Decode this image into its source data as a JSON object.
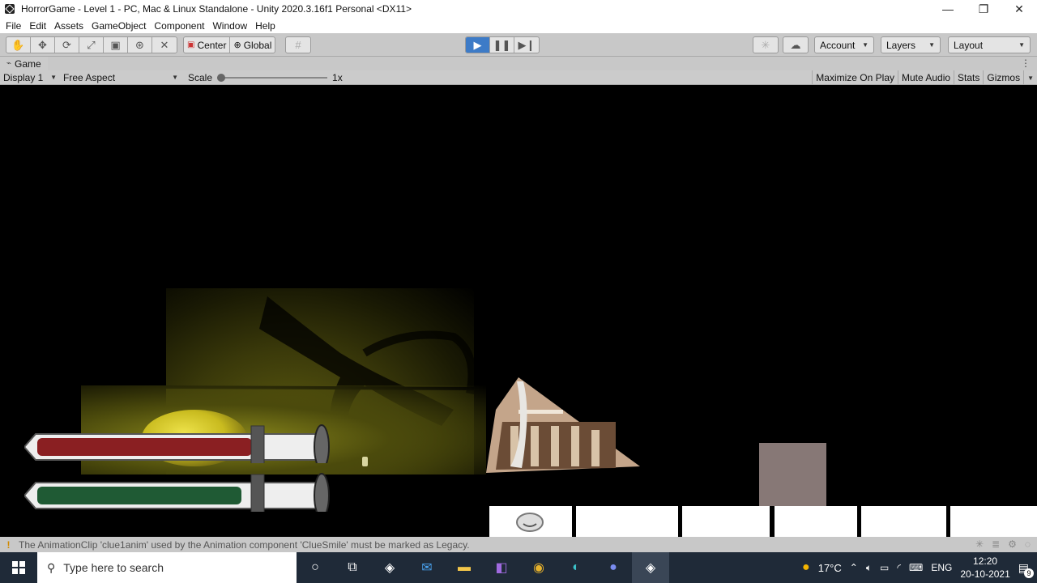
{
  "window": {
    "title": "HorrorGame - Level 1 - PC, Mac & Linux Standalone - Unity 2020.3.16f1 Personal <DX11>"
  },
  "menu": [
    "File",
    "Edit",
    "Assets",
    "GameObject",
    "Component",
    "Window",
    "Help"
  ],
  "toolbar": {
    "pivot_label": "Center",
    "space_label": "Global",
    "account_label": "Account",
    "layers_label": "Layers",
    "layout_label": "Layout"
  },
  "game_tab": {
    "label": "Game",
    "display": "Display 1",
    "aspect": "Free Aspect",
    "scale_label": "Scale",
    "scale_value": "1x",
    "maximize": "Maximize On Play",
    "mute": "Mute Audio",
    "stats": "Stats",
    "gizmos": "Gizmos"
  },
  "hud": {
    "health_fill": 0.78,
    "stamina_fill": 0.74,
    "health_color": "#8a1f22",
    "stamina_color": "#1f5a34"
  },
  "status": {
    "message": "The AnimationClip 'clue1anim' used by the Animation component 'ClueSmile' must be marked as Legacy."
  },
  "taskbar": {
    "search_placeholder": "Type here to search",
    "temperature": "17°C",
    "language": "ENG",
    "time": "12:20",
    "date": "20-10-2021",
    "notifications": "9"
  }
}
